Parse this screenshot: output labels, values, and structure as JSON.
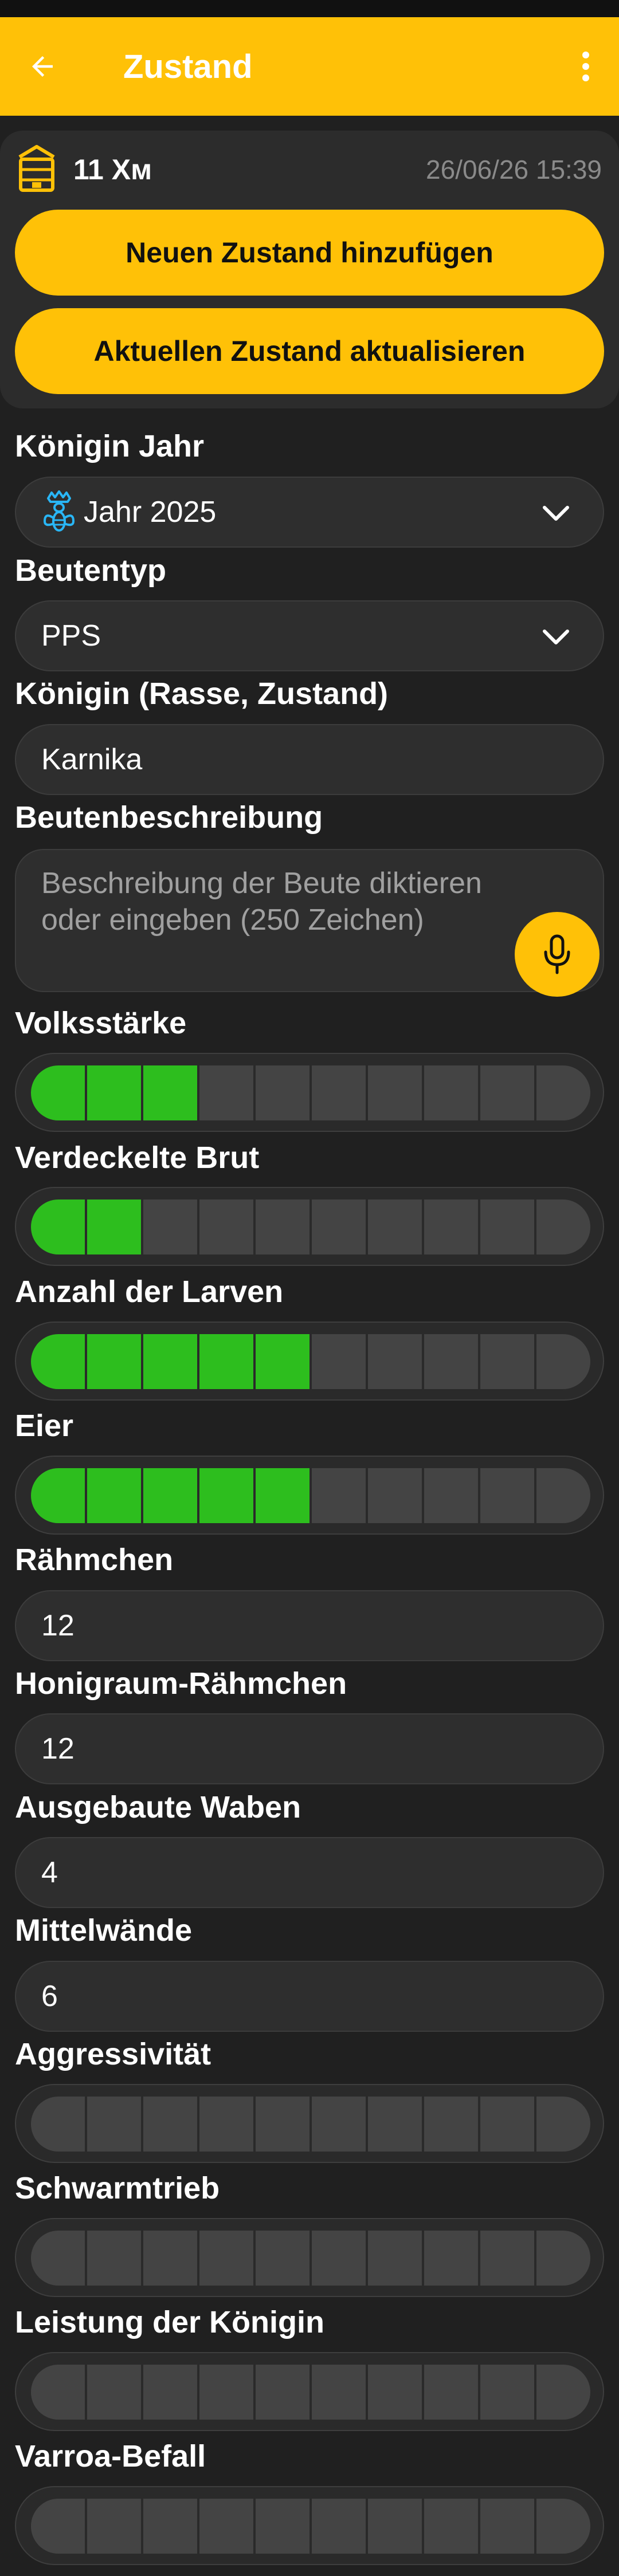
{
  "app_bar": {
    "title": "Zustand",
    "colors": {
      "accent": "#FFC107",
      "background": "#202020"
    }
  },
  "hive": {
    "name": "11 Хм",
    "date": "26/06/26 15:39",
    "icon": "beehive-icon"
  },
  "actions": {
    "add_label": "Neuen Zustand hinzufügen",
    "update_label": "Aktuellen Zustand aktualisieren"
  },
  "form": {
    "queen_year": {
      "label": "Königin Jahr",
      "value": "Jahr 2025",
      "icon": "queen-bee-icon"
    },
    "hive_type": {
      "label": "Beutentyp",
      "value": "PPS"
    },
    "queen_race": {
      "label": "Königin (Rasse, Zustand)",
      "value": "Karnika"
    },
    "hive_description": {
      "label": "Beutenbeschreibung",
      "placeholder": "Beschreibung der Beute diktieren oder eingeben (250 Zeichen)"
    },
    "colony_strength": {
      "label": "Volksstärke",
      "level": 3,
      "max": 10
    },
    "capped_brood": {
      "label": "Verdeckelte Brut",
      "level": 2,
      "max": 10
    },
    "larvae": {
      "label": "Anzahl der Larven",
      "level": 5,
      "max": 10
    },
    "eggs": {
      "label": "Eier",
      "level": 5,
      "max": 10
    },
    "frames": {
      "label": "Rähmchen",
      "value": "12"
    },
    "honey_frames": {
      "label": "Honigraum-Rähmchen",
      "value": "12"
    },
    "built_combs": {
      "label": "Ausgebaute Waben",
      "value": "4"
    },
    "foundations": {
      "label": "Mittelwände",
      "value": "6"
    },
    "aggressiveness": {
      "label": "Aggressivität",
      "level": 0,
      "max": 10
    },
    "swarm_drive": {
      "label": "Schwarmtrieb",
      "level": 0,
      "max": 10
    },
    "queen_performance": {
      "label": "Leistung der Königin",
      "level": 0,
      "max": 10
    },
    "varroa": {
      "label": "Varroa-Befall",
      "level": 0,
      "max": 10
    }
  }
}
